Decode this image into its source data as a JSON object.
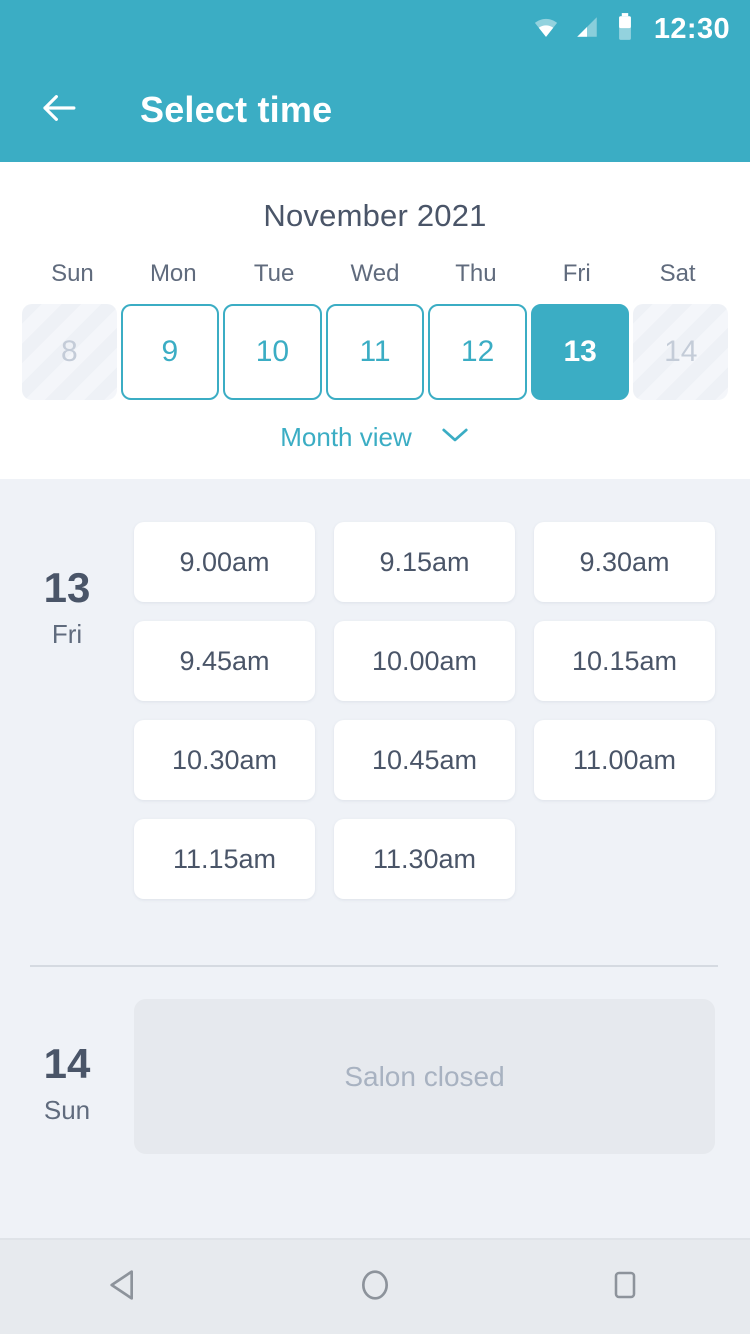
{
  "statusbar": {
    "time": "12:30",
    "icons": [
      "wifi-icon",
      "cellular-signal-icon",
      "battery-icon"
    ]
  },
  "appbar": {
    "back_icon": "arrow-left-icon",
    "title": "Select time",
    "background_color": "#3badc4"
  },
  "calendar": {
    "month_label": "November 2021",
    "weekdays": [
      "Sun",
      "Mon",
      "Tue",
      "Wed",
      "Thu",
      "Fri",
      "Sat"
    ],
    "days": [
      {
        "number": "8",
        "state": "disabled"
      },
      {
        "number": "9",
        "state": "enabled"
      },
      {
        "number": "10",
        "state": "enabled"
      },
      {
        "number": "11",
        "state": "enabled"
      },
      {
        "number": "12",
        "state": "enabled"
      },
      {
        "number": "13",
        "state": "selected"
      },
      {
        "number": "14",
        "state": "disabled"
      }
    ],
    "month_view_label": "Month view",
    "month_view_icon": "chevron-down-icon",
    "accent_color": "#3badc4"
  },
  "slots_section": {
    "groups": [
      {
        "day_number": "13",
        "day_name": "Fri",
        "slots": [
          "9.00am",
          "9.15am",
          "9.30am",
          "9.45am",
          "10.00am",
          "10.15am",
          "10.30am",
          "10.45am",
          "11.00am",
          "11.15am",
          "11.30am"
        ]
      },
      {
        "day_number": "14",
        "day_name": "Sun",
        "closed_label": "Salon closed"
      }
    ]
  },
  "navbar": {
    "back_icon": "triangle-back-icon",
    "home_icon": "circle-home-icon",
    "recents_icon": "square-recents-icon"
  }
}
